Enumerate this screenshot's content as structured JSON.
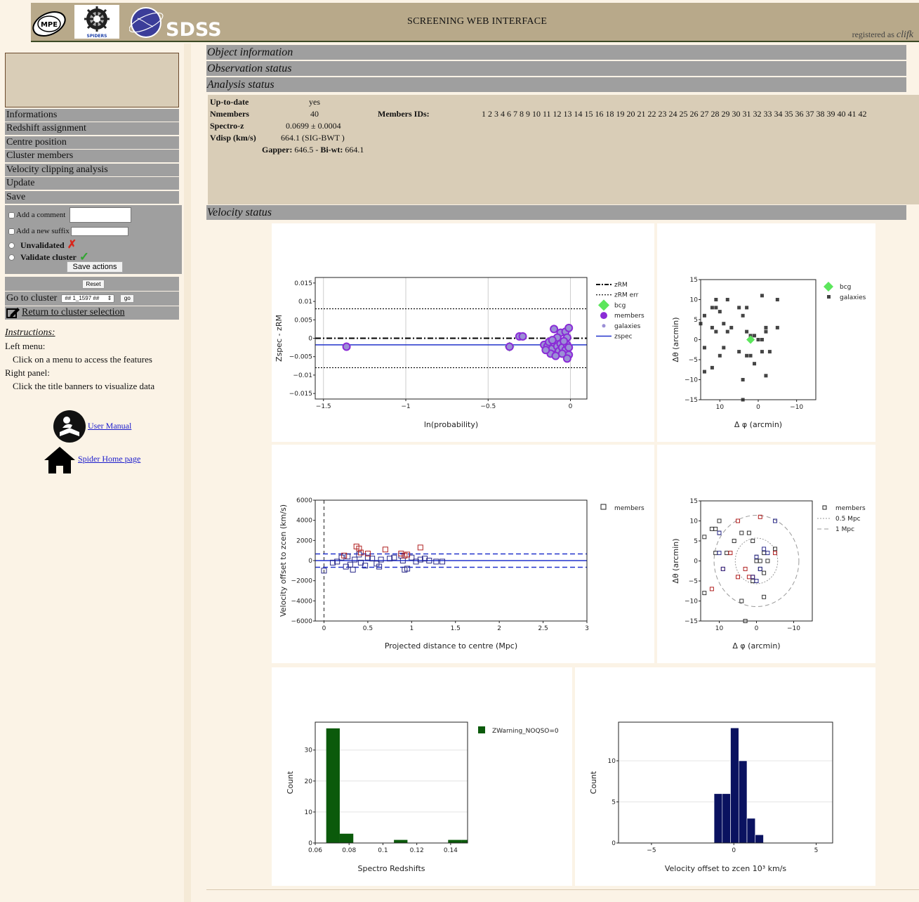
{
  "header": {
    "logo_mpe": "MPE",
    "logo_spiders": "SPIDERS",
    "logo_sdss": "SDSS",
    "title": "SCREENING WEB INTERFACE",
    "registered_as": "registered as",
    "user": "clifk"
  },
  "sidebar": {
    "items": [
      {
        "label": "Informations"
      },
      {
        "label": "Redshift assignment"
      },
      {
        "label": "Centre position"
      },
      {
        "label": "Cluster members"
      },
      {
        "label": "Velocity clipping analysis"
      },
      {
        "label": "Update"
      },
      {
        "label": "Save"
      }
    ],
    "save": {
      "add_comment": "Add a comment",
      "add_suffix": "Add a new suffix",
      "unvalidated": "Unvalidated",
      "validate": "Validate cluster",
      "save_actions": "Save actions"
    },
    "reset": "Reset",
    "goto_label": "Go to cluster",
    "goto_value": "## 1_1597 ##",
    "go": "go",
    "return_label": "Return to cluster selection",
    "instructions": {
      "title": "Instructions:",
      "left_title": "Left menu:",
      "left_text": "Click on a menu to access the features",
      "right_title": "Right panel:",
      "right_text": "Click the title banners to visualize data"
    },
    "links": {
      "manual": "User Manual",
      "home": "Spider Home page"
    }
  },
  "panels": {
    "object_info": "Object information",
    "observation_status": "Observation status",
    "analysis_status": "Analysis status",
    "velocity_status": "Velocity status"
  },
  "analysis": {
    "up_to_date_label": "Up-to-date",
    "up_to_date_value": "yes",
    "nmembers_label": "Nmembers",
    "nmembers_value": "40",
    "members_ids_label": "Members IDs:",
    "members_ids_value": "1 2 3 4 6 7 8 9 10 11 12 13 14 15 16 18 19 20 21 22 23 24 25 26 27 28 29 30 31 32 33 34 35 36 37 38 39 40 41 42",
    "spectroz_label": "Spectro-z",
    "spectroz_value": "0.0699 ± 0.0004",
    "vdisp_label": "Vdisp (km/s)",
    "vdisp_value": "664.1  (SIG-BWT )",
    "gapper_label": "Gapper:",
    "gapper_value": "646.5 - ",
    "biwt_label": "Bi-wt:",
    "biwt_value": "664.1"
  },
  "chart_data": [
    {
      "id": "zspec-vs-probability",
      "type": "scatter",
      "xlabel": "ln(probability)",
      "ylabel": "Zspec - zRM",
      "xlim": [
        -1.55,
        0.1
      ],
      "ylim": [
        -0.0165,
        0.0165
      ],
      "xticks": [
        -1.5,
        -1,
        -0.5,
        0
      ],
      "yticks": [
        -0.015,
        -0.01,
        -0.005,
        0,
        0.005,
        0.01,
        0.015
      ],
      "ytick_labels": [
        "−0.015",
        "−0.01",
        "−0.005",
        "0",
        "0.005",
        "0.01",
        "0.015"
      ],
      "xtick_labels": [
        "−1.5",
        "−1",
        "−0.5",
        "0"
      ],
      "grid": "vertical",
      "legend": [
        "zRM",
        "zRM err",
        "bcg",
        "members",
        "galaxies",
        "zspec"
      ],
      "legend_position": "right",
      "zRM": 0,
      "zRM_err": 0.008,
      "zspec": -0.0018,
      "bcg": {
        "x": -0.37,
        "y": -0.0023
      },
      "members": [
        {
          "x": -1.36,
          "y": -0.0023
        },
        {
          "x": -0.37,
          "y": -0.0023
        },
        {
          "x": -0.31,
          "y": 0.0005
        },
        {
          "x": -0.29,
          "y": 0.0005
        },
        {
          "x": -0.1,
          "y": 0.0025
        },
        {
          "x": -0.06,
          "y": 0.0015
        },
        {
          "x": -0.03,
          "y": 0.0018
        },
        {
          "x": -0.01,
          "y": 0.0028
        },
        {
          "x": -0.16,
          "y": -0.0018
        },
        {
          "x": -0.14,
          "y": -0.0022
        },
        {
          "x": -0.13,
          "y": -0.001
        },
        {
          "x": -0.11,
          "y": -0.0028
        },
        {
          "x": -0.1,
          "y": -0.0012
        },
        {
          "x": -0.09,
          "y": -0.0005
        },
        {
          "x": -0.08,
          "y": -0.0022
        },
        {
          "x": -0.07,
          "y": -0.0035
        },
        {
          "x": -0.06,
          "y": -0.0015
        },
        {
          "x": -0.05,
          "y": -0.0025
        },
        {
          "x": -0.04,
          "y": -0.0008
        },
        {
          "x": -0.03,
          "y": -0.0032
        },
        {
          "x": -0.02,
          "y": -0.0018
        },
        {
          "x": -0.02,
          "y": 0.0002
        },
        {
          "x": -0.01,
          "y": -0.0045
        },
        {
          "x": -0.01,
          "y": -0.0025
        },
        {
          "x": -0.12,
          "y": -0.0042
        },
        {
          "x": -0.09,
          "y": -0.0048
        },
        {
          "x": -0.05,
          "y": -0.0042
        },
        {
          "x": -0.15,
          "y": -0.0032
        },
        {
          "x": -0.02,
          "y": -0.0055
        },
        {
          "x": -0.08,
          "y": 0.0002
        },
        {
          "x": -0.04,
          "y": -0.0008
        },
        {
          "x": -0.11,
          "y": -0.0005
        }
      ]
    },
    {
      "id": "sky-positions-bcg",
      "type": "scatter",
      "xlabel": "Δ φ (arcmin)",
      "ylabel": "Δθ (arcmin)",
      "xlim": [
        15,
        -15
      ],
      "ylim": [
        -15,
        15
      ],
      "xticks": [
        10,
        0,
        -10
      ],
      "xtick_labels": [
        "10",
        "0",
        "−10"
      ],
      "yticks": [
        -15,
        -10,
        -5,
        0,
        5,
        10,
        15
      ],
      "ytick_labels": [
        "−15",
        "−10",
        "−5",
        "0",
        "5",
        "10",
        "15"
      ],
      "legend": [
        "bcg",
        "galaxies"
      ],
      "legend_position": "right",
      "bcg": {
        "x": 2,
        "y": 0
      },
      "galaxies": [
        [
          11,
          10
        ],
        [
          12,
          8
        ],
        [
          11,
          8
        ],
        [
          10,
          7
        ],
        [
          14,
          6
        ],
        [
          8,
          10
        ],
        [
          5,
          8
        ],
        [
          3,
          8
        ],
        [
          -1,
          11
        ],
        [
          -5,
          10
        ],
        [
          4,
          6
        ],
        [
          12,
          3
        ],
        [
          9,
          4
        ],
        [
          7,
          3
        ],
        [
          1,
          1
        ],
        [
          2,
          0
        ],
        [
          0,
          0
        ],
        [
          -2,
          3
        ],
        [
          -2,
          2
        ],
        [
          -5,
          3
        ],
        [
          11,
          2
        ],
        [
          8,
          2
        ],
        [
          3,
          2
        ],
        [
          2,
          1
        ],
        [
          15,
          4
        ],
        [
          14,
          -2
        ],
        [
          10,
          -4
        ],
        [
          12,
          -7
        ],
        [
          5,
          -3
        ],
        [
          3,
          -4
        ],
        [
          2,
          -4
        ],
        [
          1,
          -6
        ],
        [
          -1,
          -3
        ],
        [
          -3,
          -3
        ],
        [
          -1,
          0
        ],
        [
          -2,
          -9
        ],
        [
          4,
          -10
        ],
        [
          14,
          -8
        ],
        [
          9,
          -2
        ],
        [
          4,
          -15
        ]
      ]
    },
    {
      "id": "velocity-vs-distance",
      "type": "scatter",
      "xlabel": "Projected distance to centre (Mpc)",
      "ylabel": "Velocity offset to zcen (km/s)",
      "xlim": [
        -0.1,
        3
      ],
      "ylim": [
        -6000,
        6000
      ],
      "xticks": [
        0,
        0.5,
        1,
        1.5,
        2,
        2.5,
        3
      ],
      "yticks": [
        -6000,
        -4000,
        -2000,
        0,
        2000,
        4000,
        6000
      ],
      "ytick_labels": [
        "−6000",
        "−4000",
        "−2000",
        "0",
        "2000",
        "4000",
        "6000"
      ],
      "legend": [
        "members"
      ],
      "legend_position": "right",
      "sigma_line": 660,
      "members_blue": [
        [
          0.0,
          -1000
        ],
        [
          0.1,
          -200
        ],
        [
          0.15,
          -100
        ],
        [
          0.2,
          300
        ],
        [
          0.25,
          -600
        ],
        [
          0.3,
          -400
        ],
        [
          0.33,
          -900
        ],
        [
          0.35,
          100
        ],
        [
          0.4,
          600
        ],
        [
          0.42,
          -200
        ],
        [
          0.47,
          -500
        ],
        [
          0.5,
          300
        ],
        [
          0.6,
          -300
        ],
        [
          0.63,
          -600
        ],
        [
          0.65,
          100
        ],
        [
          0.75,
          200
        ],
        [
          0.8,
          300
        ],
        [
          0.88,
          500
        ],
        [
          0.9,
          0
        ],
        [
          0.92,
          -900
        ],
        [
          0.95,
          -800
        ],
        [
          1.0,
          300
        ],
        [
          1.05,
          -100
        ],
        [
          1.1,
          100
        ],
        [
          1.15,
          200
        ],
        [
          1.2,
          0
        ],
        [
          1.28,
          -100
        ],
        [
          1.35,
          -100
        ],
        [
          0.27,
          400
        ],
        [
          0.55,
          200
        ]
      ],
      "members_red": [
        [
          0.37,
          1400
        ],
        [
          0.4,
          1200
        ],
        [
          0.42,
          800
        ],
        [
          0.7,
          1100
        ],
        [
          0.88,
          700
        ],
        [
          0.92,
          500
        ],
        [
          0.95,
          600
        ],
        [
          1.1,
          1300
        ],
        [
          0.23,
          500
        ],
        [
          0.5,
          700
        ]
      ]
    },
    {
      "id": "sky-positions-members",
      "type": "scatter",
      "xlabel": "Δ φ (arcmin)",
      "ylabel": "Δθ (arcmin)",
      "xlim": [
        15,
        -15
      ],
      "ylim": [
        -15,
        15
      ],
      "xticks": [
        10,
        0,
        -10
      ],
      "xtick_labels": [
        "10",
        "0",
        "−10"
      ],
      "yticks": [
        -15,
        -10,
        -5,
        0,
        5,
        10,
        15
      ],
      "ytick_labels": [
        "−15",
        "−10",
        "−5",
        "0",
        "5",
        "10",
        "15"
      ],
      "legend": [
        "members",
        "0.5 Mpc",
        "1 Mpc"
      ],
      "legend_position": "right",
      "circle_05_radius": 5.7,
      "circle_1_radius": 11.4,
      "circle_center": [
        0,
        0
      ],
      "members_black": [
        [
          10,
          10
        ],
        [
          11,
          8
        ],
        [
          12,
          8
        ],
        [
          10,
          7
        ],
        [
          14,
          6
        ],
        [
          6,
          5
        ],
        [
          4,
          7
        ],
        [
          2,
          7
        ],
        [
          -5,
          10
        ],
        [
          1,
          5
        ],
        [
          0,
          1
        ],
        [
          -2,
          -3
        ],
        [
          -2,
          2
        ],
        [
          -5,
          3
        ],
        [
          0,
          0
        ],
        [
          -1,
          0
        ],
        [
          -3,
          0
        ],
        [
          11,
          2
        ],
        [
          8,
          2
        ],
        [
          -2,
          -9
        ],
        [
          14,
          -8
        ],
        [
          4,
          -10
        ],
        [
          1,
          -5
        ],
        [
          -1,
          -2
        ],
        [
          3,
          -15
        ]
      ],
      "members_red": [
        [
          5,
          10
        ],
        [
          -1,
          11
        ],
        [
          7,
          2
        ],
        [
          3,
          -2
        ],
        [
          1,
          -4
        ],
        [
          2,
          -4
        ],
        [
          5,
          -4
        ],
        [
          12,
          -7
        ],
        [
          9,
          -2
        ],
        [
          -5,
          2
        ]
      ],
      "members_blue": [
        [
          -5,
          10
        ],
        [
          10,
          7
        ],
        [
          0,
          1
        ],
        [
          -2,
          3
        ],
        [
          -3,
          2
        ],
        [
          1,
          -4
        ],
        [
          9,
          -2
        ],
        [
          -1,
          -2
        ],
        [
          0,
          -5
        ],
        [
          10,
          2
        ]
      ]
    },
    {
      "id": "redshift-histogram",
      "type": "bar",
      "xlabel": "Spectro Redshifts",
      "ylabel": "Count",
      "xlim": [
        0.06,
        0.15
      ],
      "ylim": [
        0,
        39
      ],
      "xticks": [
        0.06,
        0.08,
        0.1,
        0.12,
        0.14
      ],
      "xtick_labels": [
        "0.06",
        "0.08",
        "0.1",
        "0.12",
        "0.14"
      ],
      "yticks": [
        0,
        10,
        20,
        30
      ],
      "legend": [
        "ZWarning_NOQSO=0"
      ],
      "legend_position": "top-right",
      "color": "#0b5a0b",
      "bins": [
        {
          "x0": 0.0665,
          "x1": 0.0745,
          "count": 37
        },
        {
          "x0": 0.0745,
          "x1": 0.0825,
          "count": 3
        },
        {
          "x0": 0.1065,
          "x1": 0.1145,
          "count": 1
        },
        {
          "x0": 0.1385,
          "x1": 0.1465,
          "count": 1
        },
        {
          "x0": 0.1465,
          "x1": 0.15,
          "count": 1
        }
      ]
    },
    {
      "id": "velocity-histogram",
      "type": "bar",
      "xlabel": "Velocity offset to zcen 10³ km/s",
      "ylabel": "Count",
      "xlim": [
        -7,
        6
      ],
      "ylim": [
        0,
        14.7
      ],
      "xticks": [
        -5,
        0,
        5
      ],
      "xtick_labels": [
        "−5",
        "0",
        "5"
      ],
      "yticks": [
        0,
        5,
        10
      ],
      "color": "#0a1260",
      "bins": [
        {
          "x0": -1.2,
          "x1": -0.7,
          "count": 6
        },
        {
          "x0": -0.7,
          "x1": -0.2,
          "count": 6
        },
        {
          "x0": -0.2,
          "x1": 0.3,
          "count": 14
        },
        {
          "x0": 0.3,
          "x1": 0.8,
          "count": 10
        },
        {
          "x0": 0.8,
          "x1": 1.3,
          "count": 3
        },
        {
          "x0": 1.3,
          "x1": 1.8,
          "count": 1
        }
      ]
    }
  ]
}
